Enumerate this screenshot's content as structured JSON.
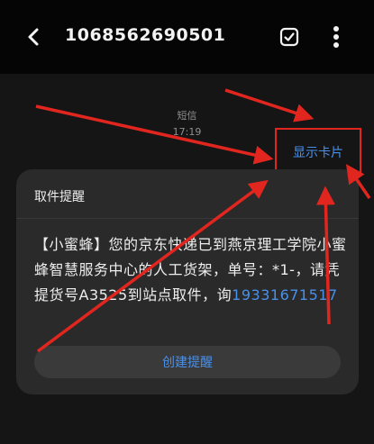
{
  "header": {
    "title": "1068562690501",
    "back_icon": "back-arrow-icon",
    "check_icon": "checkbox-icon",
    "more_icon": "more-vertical-icon"
  },
  "thread": {
    "label": "短信",
    "time": "17:19",
    "show_card_label": "显示卡片"
  },
  "message": {
    "title": "取件提醒",
    "text": "【小蜜蜂】您的京东快递已到燕京理工学院小蜜蜂智慧服务中心的人工货架，单号：*1-，请凭提货号A3525到站点取件，询",
    "phone": "19331671517",
    "create_reminder_label": "创建提醒"
  },
  "colors": {
    "accent_blue": "#4a90e8",
    "annotation_red": "#e0261e"
  }
}
